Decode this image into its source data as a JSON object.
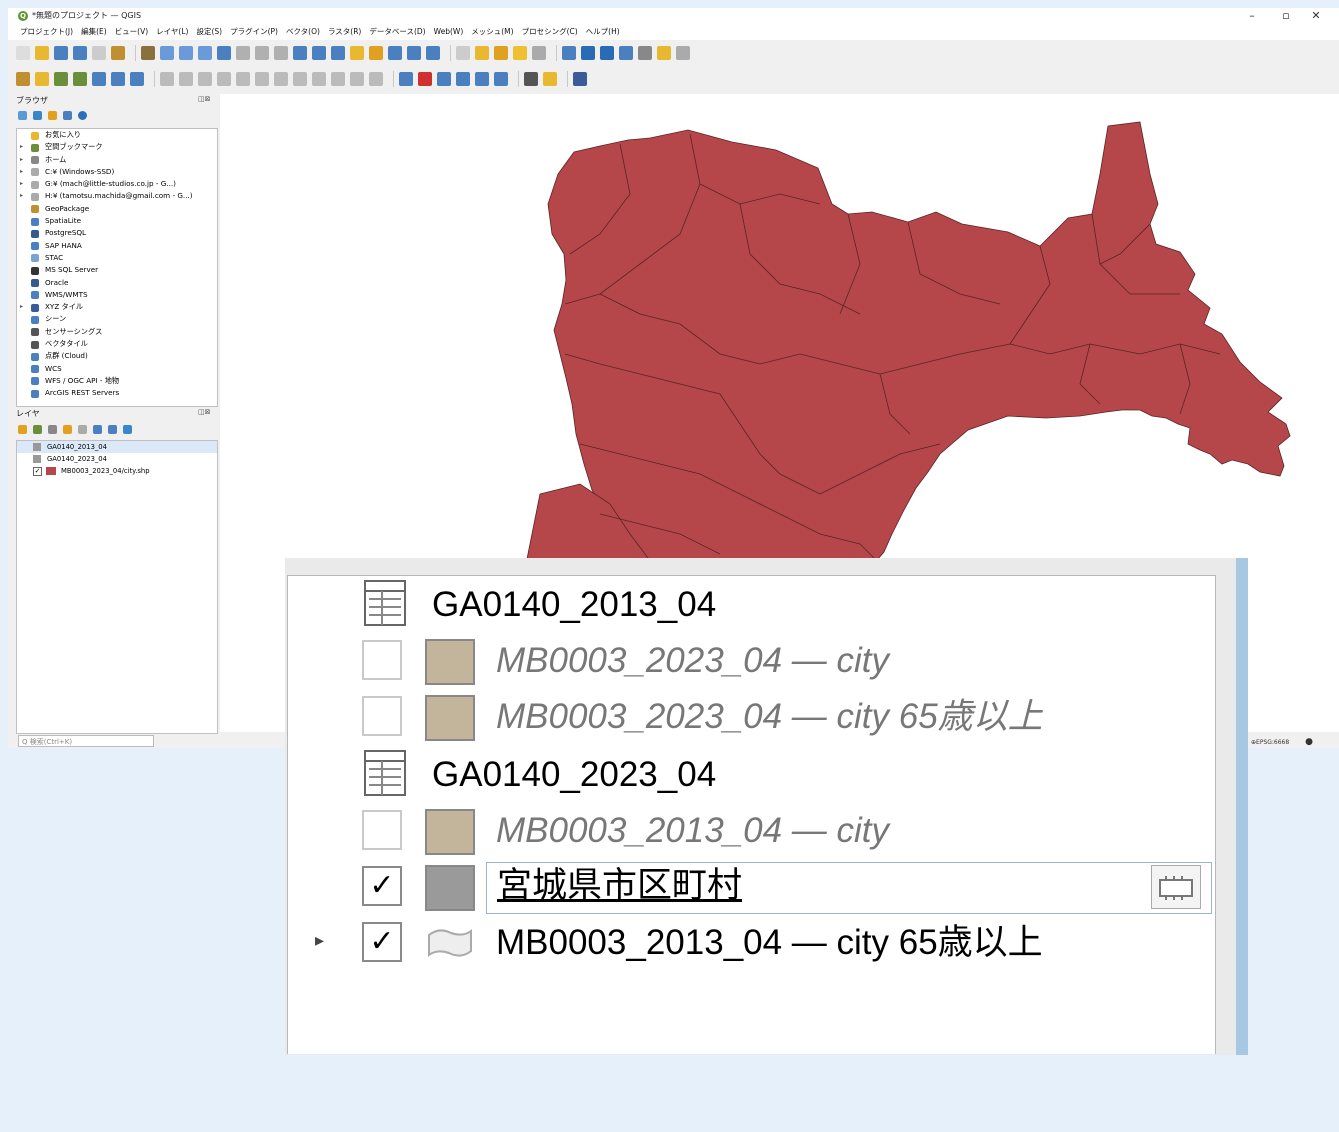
{
  "window": {
    "title": "*無題のプロジェクト — QGIS",
    "controls": [
      "–",
      "▫",
      "✕"
    ]
  },
  "menu": [
    "プロジェクト(J)",
    "編集(E)",
    "ビュー(V)",
    "レイヤ(L)",
    "設定(S)",
    "プラグイン(P)",
    "ベクタ(O)",
    "ラスタ(R)",
    "データベース(D)",
    "Web(W)",
    "メッシュ(M)",
    "プロセシング(C)",
    "ヘルプ(H)"
  ],
  "browser_panel": {
    "title": "ブラウザ",
    "items": [
      {
        "label": "お気に入り",
        "icon": "star-icon",
        "expandable": false
      },
      {
        "label": "空間ブックマーク",
        "icon": "bookmark-icon",
        "expandable": true
      },
      {
        "label": "ホーム",
        "icon": "home-icon",
        "expandable": true
      },
      {
        "label": "C:¥ (Windows-SSD)",
        "icon": "drive-icon",
        "expandable": true
      },
      {
        "label": "G:¥ (mach@little-studios.co.jp - G...)",
        "icon": "drive-icon",
        "expandable": true
      },
      {
        "label": "H:¥ (tamotsu.machida@gmail.com - G...)",
        "icon": "drive-icon",
        "expandable": true
      },
      {
        "label": "GeoPackage",
        "icon": "geopackage-icon",
        "expandable": false
      },
      {
        "label": "SpatiaLite",
        "icon": "spatialite-icon",
        "expandable": false
      },
      {
        "label": "PostgreSQL",
        "icon": "postgresql-icon",
        "expandable": false
      },
      {
        "label": "SAP HANA",
        "icon": "hana-icon",
        "expandable": false
      },
      {
        "label": "STAC",
        "icon": "stac-icon",
        "expandable": false
      },
      {
        "label": "MS SQL Server",
        "icon": "mssql-icon",
        "expandable": false
      },
      {
        "label": "Oracle",
        "icon": "oracle-icon",
        "expandable": false
      },
      {
        "label": "WMS/WMTS",
        "icon": "wms-icon",
        "expandable": false
      },
      {
        "label": "XYZ タイル",
        "icon": "xyz-icon",
        "expandable": true
      },
      {
        "label": "シーン",
        "icon": "scene-icon",
        "expandable": false
      },
      {
        "label": "センサーシングス",
        "icon": "sensor-icon",
        "expandable": false
      },
      {
        "label": "ベクタタイル",
        "icon": "vectortile-icon",
        "expandable": false
      },
      {
        "label": "点群 (Cloud)",
        "icon": "cloud-icon",
        "expandable": false
      },
      {
        "label": "WCS",
        "icon": "wcs-icon",
        "expandable": false
      },
      {
        "label": "WFS / OGC API - 地物",
        "icon": "wfs-icon",
        "expandable": false
      },
      {
        "label": "ArcGIS REST Servers",
        "icon": "arcgis-icon",
        "expandable": false
      }
    ]
  },
  "layers_panel": {
    "title": "レイヤ",
    "items": [
      {
        "label": "GA0140_2013_04",
        "type": "group",
        "checked": false
      },
      {
        "label": "GA0140_2023_04",
        "type": "group",
        "checked": false
      },
      {
        "label": "MB0003_2023_04/city.shp",
        "type": "layer",
        "checked": true,
        "color": "#b5474b"
      }
    ]
  },
  "search": {
    "placeholder": "Q 検索(Ctrl+K)"
  },
  "status": {
    "crs": "EPSG:6668"
  },
  "map": {
    "fill": "#b5474b",
    "stroke": "#5a2325"
  },
  "zoom_view": {
    "rows": [
      {
        "kind": "group",
        "label": "GA0140_2013_04"
      },
      {
        "kind": "layer",
        "label": "MB0003_2023_04 — city",
        "checked": false,
        "dim": true,
        "swatch": "#c2b59b"
      },
      {
        "kind": "layer",
        "label": "MB0003_2023_04 — city 65歳以上",
        "checked": false,
        "dim": true,
        "swatch": "#c2b59b"
      },
      {
        "kind": "group",
        "label": "GA0140_2023_04"
      },
      {
        "kind": "layer",
        "label": "MB0003_2013_04 — city",
        "checked": false,
        "dim": true,
        "swatch": "#c2b59b"
      },
      {
        "kind": "editing",
        "label": "宮城県市区町村",
        "checked": true,
        "swatch": "#9a9a9a",
        "check_mark": "✓"
      },
      {
        "kind": "layer-expand",
        "label": "MB0003_2013_04 — city 65歳以上",
        "checked": true,
        "check_mark": "✓",
        "expand_arrow": "▸"
      }
    ]
  }
}
